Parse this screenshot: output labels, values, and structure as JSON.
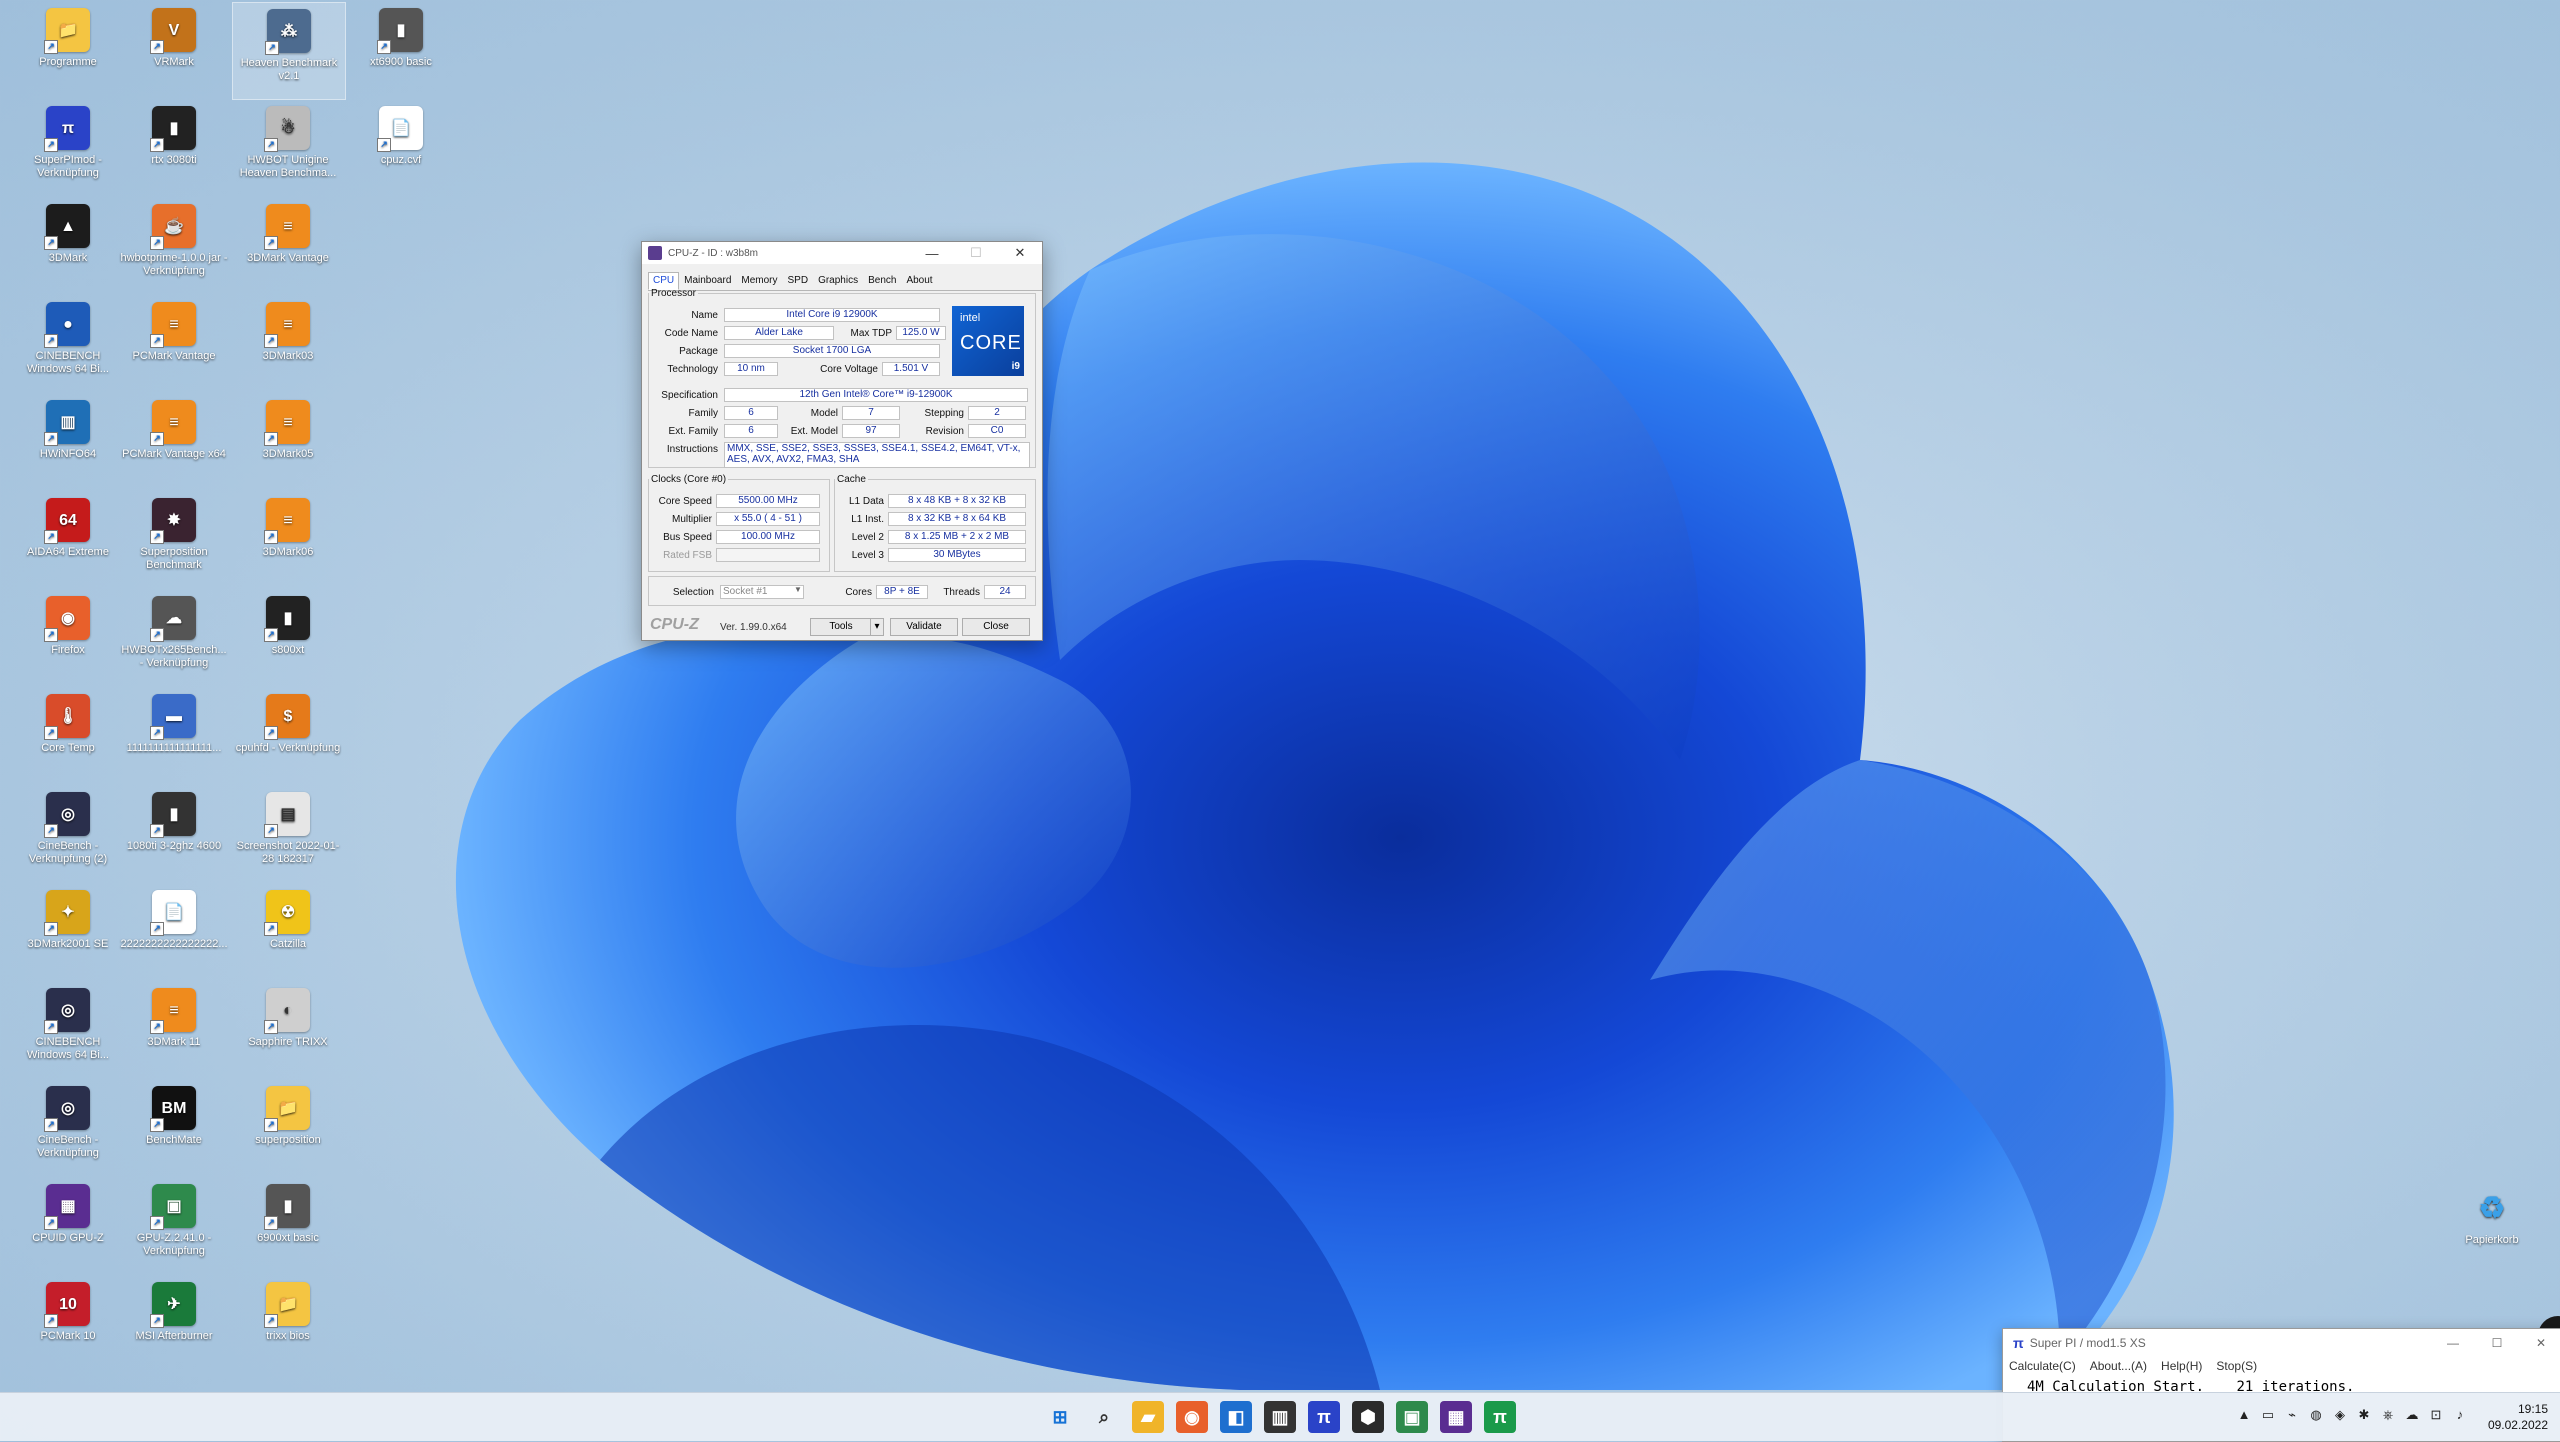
{
  "desktop_icons": [
    {
      "label": "Programme",
      "glyph": "📁",
      "color": "#f4c542",
      "selected": false
    },
    {
      "label": "SuperPImod - Verknüpfung",
      "glyph": "π",
      "color": "#2a43c8",
      "selected": false
    },
    {
      "label": "3DMark",
      "glyph": "▲",
      "color": "#1c1c1c",
      "selected": false
    },
    {
      "label": "CINEBENCH Windows 64 Bi...",
      "glyph": "●",
      "color": "#1e5bb8",
      "selected": false
    },
    {
      "label": "HWiNFO64",
      "glyph": "▥",
      "color": "#1f6fb6",
      "selected": false
    },
    {
      "label": "AIDA64 Extreme",
      "glyph": "64",
      "color": "#c51b1b",
      "selected": false
    },
    {
      "label": "Firefox",
      "glyph": "◉",
      "color": "#e8602b",
      "selected": false
    },
    {
      "label": "Core Temp",
      "glyph": "🌡",
      "color": "#d94c2a",
      "selected": false
    },
    {
      "label": "CineBench - Verknüpfung (2)",
      "glyph": "◎",
      "color": "#2a2f4c",
      "selected": false
    },
    {
      "label": "3DMark2001 SE",
      "glyph": "✦",
      "color": "#d8a51a",
      "selected": false
    },
    {
      "label": "CINEBENCH Windows 64 Bi...",
      "glyph": "◎",
      "color": "#2a2f4c",
      "selected": false
    },
    {
      "label": "CineBench - Verknüpfung",
      "glyph": "◎",
      "color": "#2a2f4c",
      "selected": false
    },
    {
      "label": "CPUID GPU-Z",
      "glyph": "▦",
      "color": "#5a2d91",
      "selected": false
    },
    {
      "label": "PCMark 10",
      "glyph": "10",
      "color": "#c41e2a",
      "selected": false
    },
    {
      "label": "VRMark",
      "glyph": "V",
      "color": "#c2721a",
      "selected": false
    },
    {
      "label": "rtx 3080ti",
      "glyph": "▮",
      "color": "#222",
      "selected": false
    },
    {
      "label": "hwbotprime-1.0.0.jar - Verknüpfung",
      "glyph": "☕",
      "color": "#e76f2b",
      "selected": false
    },
    {
      "label": "PCMark Vantage",
      "glyph": "≡",
      "color": "#ef8b1d",
      "selected": false
    },
    {
      "label": "PCMark Vantage x64",
      "glyph": "≡",
      "color": "#ef8b1d",
      "selected": false
    },
    {
      "label": "Superposition Benchmark",
      "glyph": "✸",
      "color": "#3a2330",
      "selected": false
    },
    {
      "label": "HWBOTx265Bench... - Verknüpfung",
      "glyph": "☁",
      "color": "#555",
      "selected": false
    },
    {
      "label": "1111111111111111...",
      "glyph": "▬",
      "color": "#3a6bc8",
      "selected": false
    },
    {
      "label": "1080ti 3-2ghz 4600",
      "glyph": "▮",
      "color": "#333",
      "selected": false
    },
    {
      "label": "2222222222222222...",
      "glyph": "📄",
      "color": "#ffffff",
      "selected": false
    },
    {
      "label": "3DMark 11",
      "glyph": "≡",
      "color": "#ef8b1d",
      "selected": false
    },
    {
      "label": "BenchMate",
      "glyph": "BM",
      "color": "#111",
      "selected": false
    },
    {
      "label": "GPU-Z.2.41.0 - Verknüpfung",
      "glyph": "▣",
      "color": "#2e8a4c",
      "selected": false
    },
    {
      "label": "MSI Afterburner",
      "glyph": "✈",
      "color": "#1a7a3a",
      "selected": false
    },
    {
      "label": "Heaven Benchmark v2.1",
      "glyph": "⁂",
      "color": "#4d6b8f",
      "selected": true
    },
    {
      "label": "HWBOT Unigine Heaven Benchma...",
      "glyph": "☃",
      "color": "#bbbbbb",
      "selected": false
    },
    {
      "label": "3DMark Vantage",
      "glyph": "≡",
      "color": "#ef8b1d",
      "selected": false
    },
    {
      "label": "3DMark03",
      "glyph": "≡",
      "color": "#ef8b1d",
      "selected": false
    },
    {
      "label": "3DMark05",
      "glyph": "≡",
      "color": "#ef8b1d",
      "selected": false
    },
    {
      "label": "3DMark06",
      "glyph": "≡",
      "color": "#ef8b1d",
      "selected": false
    },
    {
      "label": "s800xt",
      "glyph": "▮",
      "color": "#222",
      "selected": false
    },
    {
      "label": "cpuhfd - Verknüpfung",
      "glyph": "$",
      "color": "#e57a1a",
      "selected": false
    },
    {
      "label": "Screenshot 2022-01-28 182317",
      "glyph": "▤",
      "color": "#e6e6e6",
      "selected": false
    },
    {
      "label": "Catzilla",
      "glyph": "☢",
      "color": "#f0c419",
      "selected": false
    },
    {
      "label": "Sapphire TRIXX",
      "glyph": "◐",
      "color": "#cfcfcf",
      "selected": false
    },
    {
      "label": "superposition",
      "glyph": "📁",
      "color": "#f4c542",
      "selected": false
    },
    {
      "label": "6900xt basic",
      "glyph": "▮",
      "color": "#555",
      "selected": false
    },
    {
      "label": "trixx bios",
      "glyph": "📁",
      "color": "#f4c542",
      "selected": false
    },
    {
      "label": "xt6900 basic",
      "glyph": "▮",
      "color": "#555",
      "selected": false
    },
    {
      "label": "cpuz.cvf",
      "glyph": "📄",
      "color": "#ffffff",
      "selected": false
    },
    {
      "label": "Papierkorb",
      "glyph": "♻",
      "color": "#cfe3f6",
      "selected": false
    }
  ],
  "cpuz": {
    "title": "CPU-Z - ID : w3b8m",
    "tabs": [
      "CPU",
      "Mainboard",
      "Memory",
      "SPD",
      "Graphics",
      "Bench",
      "About"
    ],
    "active_tab": "CPU",
    "processor_legend": "Processor",
    "labels": {
      "name": "Name",
      "code_name": "Code Name",
      "max_tdp": "Max TDP",
      "package": "Package",
      "technology": "Technology",
      "core_voltage": "Core Voltage",
      "specification": "Specification",
      "family": "Family",
      "model": "Model",
      "stepping": "Stepping",
      "ext_family": "Ext. Family",
      "ext_model": "Ext. Model",
      "revision": "Revision",
      "instructions": "Instructions"
    },
    "values": {
      "name": "Intel Core i9 12900K",
      "code_name": "Alder Lake",
      "max_tdp": "125.0 W",
      "package": "Socket 1700 LGA",
      "technology": "10 nm",
      "core_voltage": "1.501 V",
      "specification": "12th Gen Intel® Core™ i9-12900K",
      "family": "6",
      "model": "7",
      "stepping": "2",
      "ext_family": "6",
      "ext_model": "97",
      "revision": "C0",
      "instructions": "MMX, SSE, SSE2, SSE3, SSSE3, SSE4.1, SSE4.2, EM64T, VT-x, AES, AVX, AVX2, FMA3, SHA"
    },
    "logo": {
      "brand": "intel",
      "line": "CORE",
      "tier": "i9"
    },
    "clocks": {
      "legend": "Clocks (Core #0)",
      "core_speed_label": "Core Speed",
      "core_speed": "5500.00 MHz",
      "multiplier_label": "Multiplier",
      "multiplier": "x 55.0 ( 4 - 51 )",
      "bus_speed_label": "Bus Speed",
      "bus_speed": "100.00 MHz",
      "rated_fsb_label": "Rated FSB",
      "rated_fsb": ""
    },
    "cache": {
      "legend": "Cache",
      "l1d_label": "L1 Data",
      "l1d": "8 x 48 KB + 8 x 32 KB",
      "l1i_label": "L1 Inst.",
      "l1i": "8 x 32 KB + 8 x 64 KB",
      "l2_label": "Level 2",
      "l2": "8 x 1.25 MB + 2 x 2 MB",
      "l3_label": "Level 3",
      "l3": "30 MBytes"
    },
    "selection_label": "Selection",
    "selection": "Socket #1",
    "cores_label": "Cores",
    "cores": "8P + 8E",
    "threads_label": "Threads",
    "threads": "24",
    "brand_footer": "CPU-Z",
    "version": "Ver. 1.99.0.x64",
    "tools_btn": "Tools",
    "validate_btn": "Validate",
    "close_btn": "Close",
    "accent": "#1f4dd9"
  },
  "superpi": {
    "title": "Super PI / mod1.5 XS",
    "menu": [
      "Calculate(C)",
      "About...(A)",
      "Help(H)",
      "Stop(S)"
    ],
    "text_left": "4M Calculation Start.",
    "text_right": "21 iterations."
  },
  "taskbar": {
    "apps": [
      {
        "name": "start-button",
        "glyph": "⊞",
        "color": "#1572d6"
      },
      {
        "name": "search-icon",
        "glyph": "⌕",
        "color": "#333"
      },
      {
        "name": "file-explorer-icon",
        "glyph": "▰",
        "color": "#f0b429"
      },
      {
        "name": "firefox-icon",
        "glyph": "◉",
        "color": "#e8602b"
      },
      {
        "name": "app-icon-1",
        "glyph": "◧",
        "color": "#1e6fcf"
      },
      {
        "name": "hwinfo-icon",
        "glyph": "▥",
        "color": "#333"
      },
      {
        "name": "superpi-taskbar-icon",
        "glyph": "π",
        "color": "#2a43c8"
      },
      {
        "name": "app-icon-2",
        "glyph": "⬢",
        "color": "#2b2b2b"
      },
      {
        "name": "gpuz-taskbar-icon",
        "glyph": "▣",
        "color": "#2e8a4c"
      },
      {
        "name": "cpuz-taskbar-icon",
        "glyph": "▦",
        "color": "#5a2d91"
      },
      {
        "name": "superpi-taskbar-icon-2",
        "glyph": "π",
        "color": "#1a9a4a"
      }
    ],
    "tray": [
      "▲",
      "▭",
      "⌁",
      "◍",
      "◈",
      "✱",
      "⎈",
      "☁",
      "⊡",
      "♪"
    ],
    "time": "19:15",
    "date": "09.02.2022"
  }
}
